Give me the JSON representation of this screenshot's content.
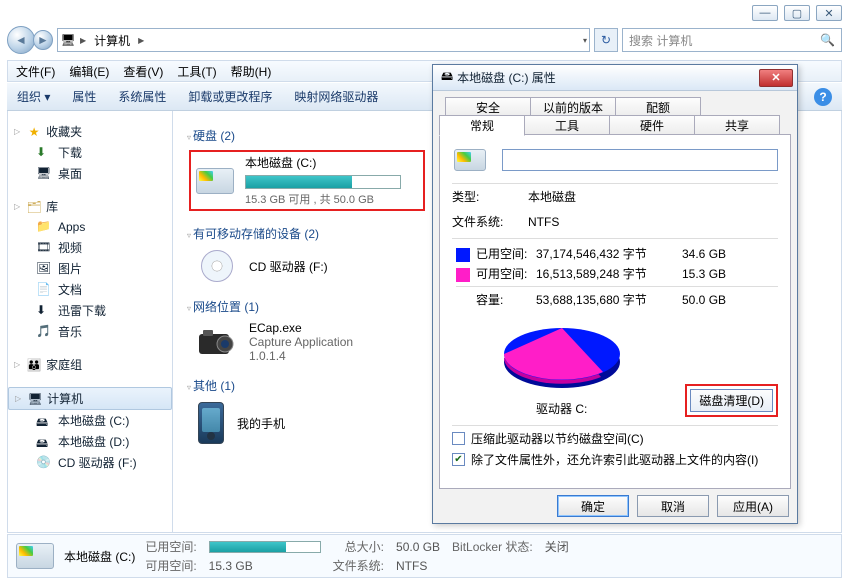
{
  "window_controls": {
    "min": "—",
    "max": "▢",
    "close": "✕"
  },
  "nav": {
    "back": "◄",
    "fwd": "►",
    "breadcrumb": {
      "icon": "🖥",
      "label": "计算机",
      "sep": "▶",
      "sep2": "▶"
    },
    "refresh": "↻",
    "search_placeholder": "搜索 计算机",
    "search_icon": "🔍"
  },
  "menu": {
    "file": "文件(F)",
    "edit": "编辑(E)",
    "view": "查看(V)",
    "tools": "工具(T)",
    "help": "帮助(H)"
  },
  "cmd": {
    "org": "组织 ▾",
    "prop": "属性",
    "sysprop": "系统属性",
    "uninstall": "卸载或更改程序",
    "map": "映射网络驱动器",
    "help": "?"
  },
  "side": {
    "fav": {
      "label": "收藏夹",
      "items": [
        {
          "icon": "⬇",
          "label": "下载"
        },
        {
          "icon": "🖥",
          "label": "桌面"
        }
      ]
    },
    "lib": {
      "label": "库",
      "items": [
        {
          "icon": "📁",
          "label": "Apps"
        },
        {
          "icon": "🎞",
          "label": "视频"
        },
        {
          "icon": "🖼",
          "label": "图片"
        },
        {
          "icon": "📄",
          "label": "文档"
        },
        {
          "icon": "⬇",
          "label": "迅雷下载"
        },
        {
          "icon": "🎵",
          "label": "音乐"
        }
      ]
    },
    "home": {
      "label": "家庭组",
      "icon": "👪"
    },
    "comp": {
      "label": "计算机",
      "icon": "🖥",
      "items": [
        {
          "label": "本地磁盘 (C:)"
        },
        {
          "label": "本地磁盘 (D:)"
        },
        {
          "label": "CD 驱动器 (F:)"
        }
      ]
    }
  },
  "main": {
    "hdd": {
      "header": "硬盘 (2)",
      "drive": {
        "name": "本地磁盘 (C:)",
        "free_text": "15.3 GB 可用 , 共 50.0 GB",
        "fill_percent": 69
      }
    },
    "removable": {
      "header": "有可移动存储的设备 (2)",
      "cd": "CD 驱动器 (F:)"
    },
    "netloc": {
      "header": "网络位置 (1)",
      "app": {
        "name": "ECap.exe",
        "desc": "Capture Application",
        "ver": "1.0.1.4"
      }
    },
    "other": {
      "header": "其他 (1)",
      "phone": "我的手机"
    }
  },
  "status": {
    "name": "本地磁盘 (C:)",
    "used_label": "已用空间:",
    "free_label": "可用空间:",
    "free_value": "15.3 GB",
    "total_label": "总大小:",
    "total_value": "50.0 GB",
    "bitlocker_label": "BitLocker 状态:",
    "bitlocker_value": "关闭",
    "fs_label": "文件系统:",
    "fs_value": "NTFS",
    "fill_percent": 69
  },
  "dialog": {
    "title": "本地磁盘 (C:) 属性",
    "close": "✕",
    "tabs_back": [
      "安全",
      "以前的版本",
      "配额"
    ],
    "tabs_front": [
      "常规",
      "工具",
      "硬件",
      "共享"
    ],
    "active_tab": "常规",
    "type_label": "类型:",
    "type_value": "本地磁盘",
    "fs_label": "文件系统:",
    "fs_value": "NTFS",
    "used": {
      "label": "已用空间:",
      "bytes": "37,174,546,432 字节",
      "human": "34.6 GB"
    },
    "free": {
      "label": "可用空间:",
      "bytes": "16,513,589,248 字节",
      "human": "15.3 GB"
    },
    "cap": {
      "label": "容量:",
      "bytes": "53,688,135,680 字节",
      "human": "50.0 GB"
    },
    "drive_label": "驱动器 C:",
    "cleanup": "磁盘清理(D)",
    "chk_compress": "压缩此驱动器以节约磁盘空间(C)",
    "chk_index": "除了文件属性外，还允许索引此驱动器上文件的内容(I)",
    "chk_index_checked": true,
    "ok": "确定",
    "cancel": "取消",
    "apply": "应用(A)"
  },
  "chart_data": {
    "type": "pie",
    "title": "驱动器 C:",
    "series": [
      {
        "name": "已用空间",
        "value": 34.6,
        "percent": 69.2,
        "color": "#0018ff"
      },
      {
        "name": "可用空间",
        "value": 15.3,
        "percent": 30.8,
        "color": "#ff1ec8"
      }
    ],
    "unit": "GB",
    "total": 50.0
  }
}
